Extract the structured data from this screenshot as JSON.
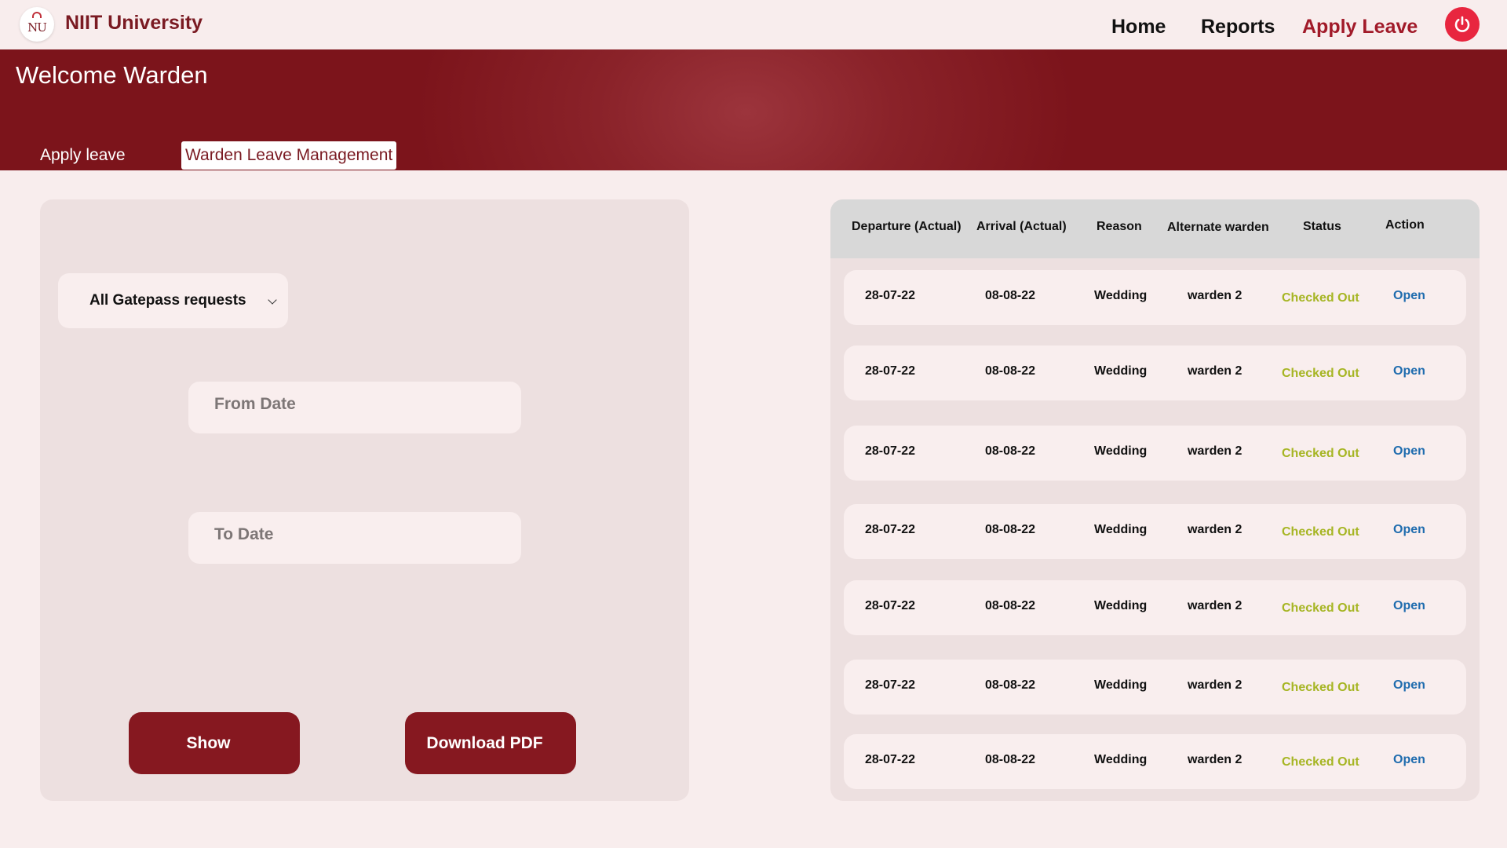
{
  "header": {
    "logo_text": "NU",
    "brand": "NIIT University",
    "nav": {
      "home": "Home",
      "reports": "Reports",
      "apply_leave": "Apply Leave"
    },
    "power_icon": "power-icon",
    "colors": {
      "brand": "#7a1a22",
      "active_nav": "#a11a29",
      "power": "#e8263f"
    }
  },
  "banner": {
    "welcome": "Welcome Warden",
    "tabs": {
      "apply": "Apply leave",
      "warden": "Warden Leave Management"
    }
  },
  "filter": {
    "select_value": "All Gatepass requests",
    "from_placeholder": "From Date",
    "to_placeholder": "To Date",
    "show_label": "Show",
    "download_label": "Download PDF"
  },
  "table": {
    "headers": {
      "departure": "Departure (Actual)",
      "arrival": "Arrival (Actual)",
      "reason": "Reason",
      "alternate": "Alternate warden",
      "status": "Status",
      "action": "Action"
    },
    "rows": [
      {
        "departure": "28-07-22",
        "arrival": "08-08-22",
        "reason": "Wedding",
        "alternate": "warden 2",
        "status": "Checked Out",
        "action": "Open"
      },
      {
        "departure": "28-07-22",
        "arrival": "08-08-22",
        "reason": "Wedding",
        "alternate": "warden 2",
        "status": "Checked Out",
        "action": "Open"
      },
      {
        "departure": "28-07-22",
        "arrival": "08-08-22",
        "reason": "Wedding",
        "alternate": "warden 2",
        "status": "Checked Out",
        "action": "Open"
      },
      {
        "departure": "28-07-22",
        "arrival": "08-08-22",
        "reason": "Wedding",
        "alternate": "warden 2",
        "status": "Checked Out",
        "action": "Open"
      },
      {
        "departure": "28-07-22",
        "arrival": "08-08-22",
        "reason": "Wedding",
        "alternate": "warden 2",
        "status": "Checked Out",
        "action": "Open"
      },
      {
        "departure": "28-07-22",
        "arrival": "08-08-22",
        "reason": "Wedding",
        "alternate": "warden 2",
        "status": "Checked Out",
        "action": "Open"
      },
      {
        "departure": "28-07-22",
        "arrival": "08-08-22",
        "reason": "Wedding",
        "alternate": "warden 2",
        "status": "Checked Out",
        "action": "Open"
      }
    ],
    "colors": {
      "status": "#a6b523",
      "action": "#1f6cae"
    }
  }
}
